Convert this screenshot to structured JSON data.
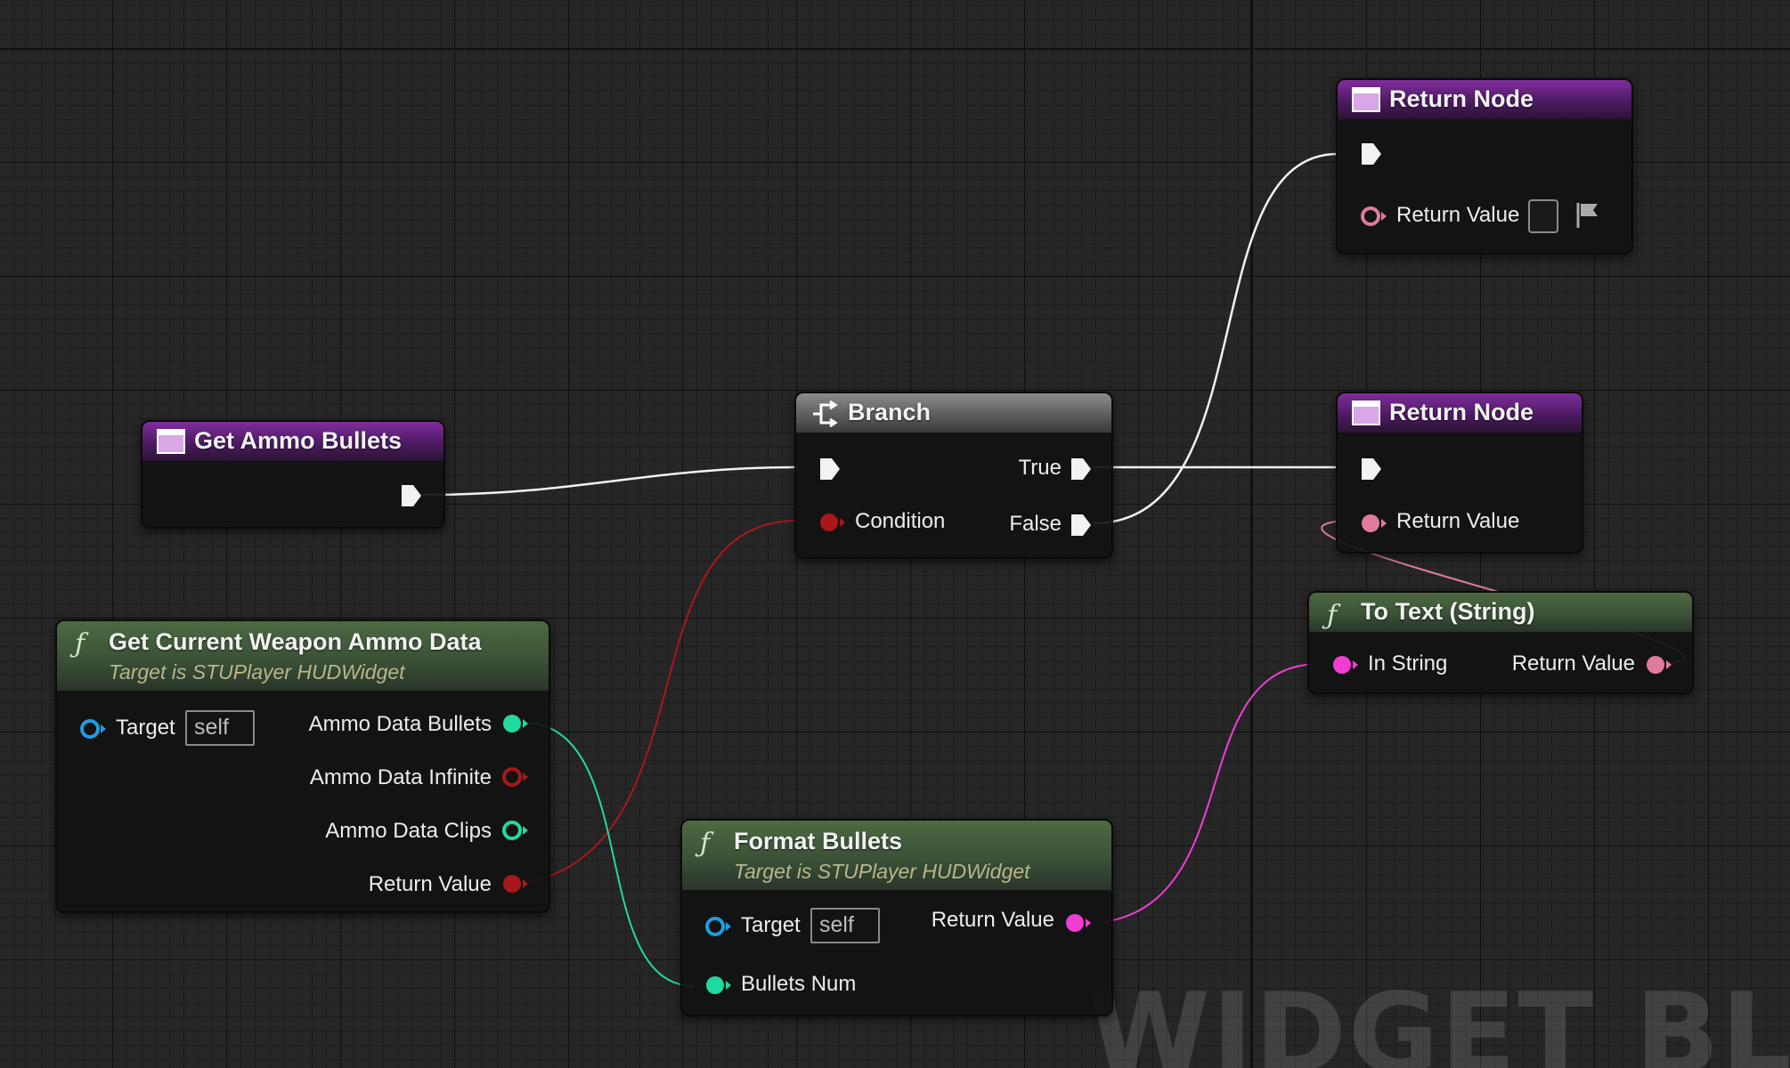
{
  "watermark": "WIDGET BLUEPRINT",
  "colors": {
    "exec": "#f2f2f2",
    "bool": "#a8181a",
    "int": "#20d9a0",
    "string": "#f13dd3",
    "text": "#e07ba0",
    "object": "#1f9de0",
    "purple_header": "#6a2a86",
    "green_header": "#41603e",
    "branch_header": "#777777"
  },
  "nodes": {
    "get_ammo_bullets": {
      "title": "Get Ammo Bullets",
      "icon": "function-entry-icon"
    },
    "get_current_weapon_ammo_data": {
      "title": "Get Current Weapon Ammo Data",
      "subtitle": "Target is STUPlayer HUDWidget",
      "icon": "function-icon",
      "target_label": "Target",
      "target_value": "self",
      "outputs": [
        "Ammo Data Bullets",
        "Ammo Data Infinite",
        "Ammo Data Clips",
        "Return Value"
      ]
    },
    "branch": {
      "title": "Branch",
      "icon": "branch-icon",
      "condition_label": "Condition",
      "true_label": "True",
      "false_label": "False"
    },
    "return_node_top": {
      "title": "Return Node",
      "icon": "function-result-icon",
      "return_label": "Return Value"
    },
    "return_node_mid": {
      "title": "Return Node",
      "icon": "function-result-icon",
      "return_label": "Return Value"
    },
    "to_text_string": {
      "title": "To Text (String)",
      "icon": "function-icon",
      "in_label": "In String",
      "out_label": "Return Value"
    },
    "format_bullets": {
      "title": "Format Bullets",
      "subtitle": "Target is STUPlayer HUDWidget",
      "icon": "function-icon",
      "target_label": "Target",
      "target_value": "self",
      "return_label": "Return Value",
      "bullets_label": "Bullets Num"
    }
  }
}
